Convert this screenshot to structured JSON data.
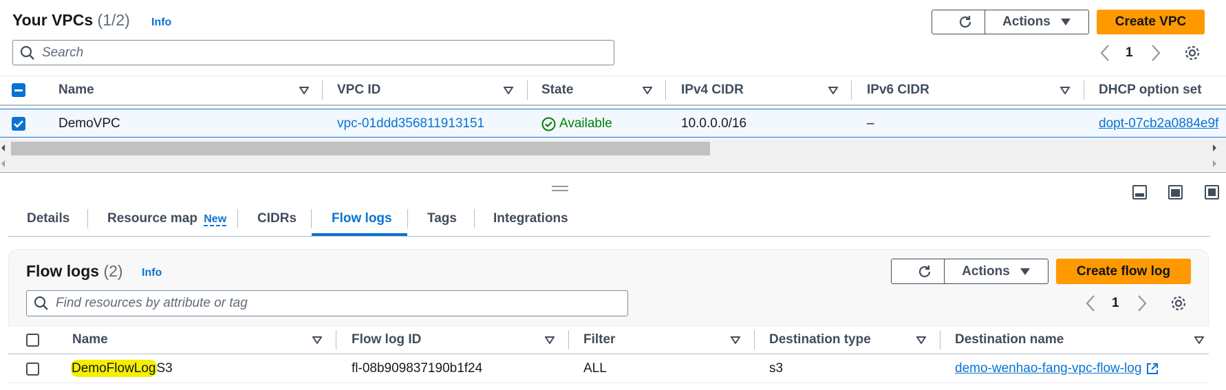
{
  "vpcs": {
    "title": "Your VPCs",
    "count": "(1/2)",
    "info": "Info",
    "refresh_icon": "refresh-icon",
    "actions_label": "Actions",
    "create_label": "Create VPC",
    "search_placeholder": "Search",
    "page": "1",
    "columns": [
      "Name",
      "VPC ID",
      "State",
      "IPv4 CIDR",
      "IPv6 CIDR",
      "DHCP option set"
    ],
    "row": {
      "name": "DemoVPC",
      "vpc_id": "vpc-01ddd356811913151",
      "state": "Available",
      "ipv4": "10.0.0.0/16",
      "ipv6": "–",
      "dhcp": "dopt-07cb2a0884e9f"
    }
  },
  "tabs": [
    {
      "label": "Details"
    },
    {
      "label": "Resource map",
      "badge": "New"
    },
    {
      "label": "CIDRs"
    },
    {
      "label": "Flow logs",
      "active": true
    },
    {
      "label": "Tags"
    },
    {
      "label": "Integrations"
    }
  ],
  "flowlogs": {
    "title": "Flow logs",
    "count": "(2)",
    "info": "Info",
    "actions_label": "Actions",
    "create_label": "Create flow log",
    "search_placeholder": "Find resources by attribute or tag",
    "page": "1",
    "columns": [
      "Name",
      "Flow log ID",
      "Filter",
      "Destination type",
      "Destination name"
    ],
    "row": {
      "name_highlight": "DemoFlowLog",
      "name_rest": "S3",
      "id": "fl-08b909837190b1f24",
      "filter": "ALL",
      "dest_type": "s3",
      "dest_name": "demo-wenhao-fang-vpc-flow-log"
    }
  },
  "colors": {
    "primary": "#ff9900",
    "link": "#0972d3",
    "success": "#037f0c",
    "highlight": "#f5ef00"
  }
}
